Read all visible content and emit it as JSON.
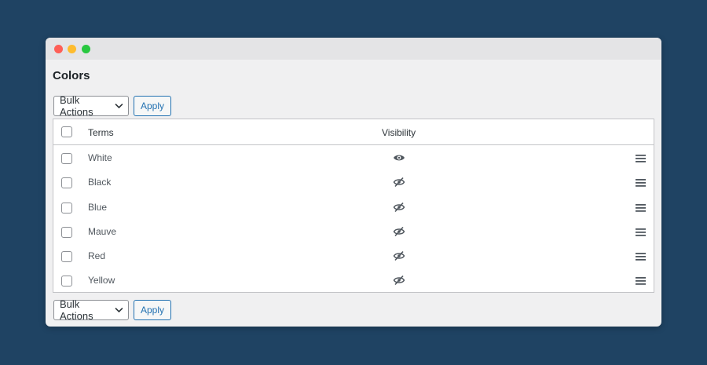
{
  "window": {
    "title": ""
  },
  "page": {
    "title": "Colors"
  },
  "bulk_actions": {
    "selected": "Bulk Actions",
    "apply_label": "Apply"
  },
  "table": {
    "columns": {
      "terms": "Terms",
      "visibility": "Visibility"
    },
    "rows": [
      {
        "term": "White",
        "visibility": "visible",
        "icon": "eye-icon"
      },
      {
        "term": "Black",
        "visibility": "hidden",
        "icon": "eye-slash-icon"
      },
      {
        "term": "Blue",
        "visibility": "hidden",
        "icon": "eye-slash-icon"
      },
      {
        "term": "Mauve",
        "visibility": "hidden",
        "icon": "eye-slash-icon"
      },
      {
        "term": "Red",
        "visibility": "hidden",
        "icon": "eye-slash-icon"
      },
      {
        "term": "Yellow",
        "visibility": "hidden",
        "icon": "eye-slash-icon"
      }
    ]
  },
  "colors": {
    "background": "#1f4363",
    "accent": "#2271b1",
    "window": "#f0f0f1"
  }
}
